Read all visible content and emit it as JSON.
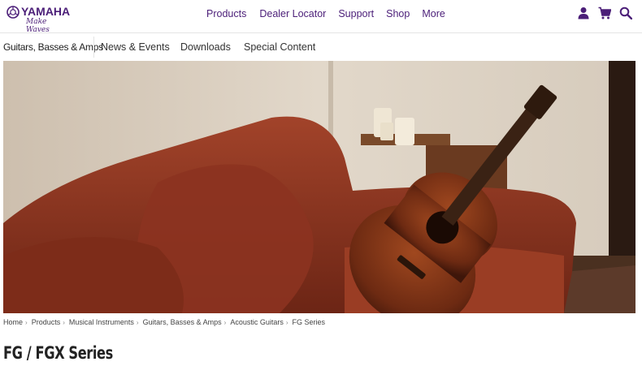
{
  "brand": {
    "name": "YAMAHA",
    "tagline": "Make Waves",
    "color": "#4b1e78"
  },
  "main_nav": {
    "items": [
      "Products",
      "Dealer Locator",
      "Support",
      "Shop",
      "More"
    ]
  },
  "header_icons": [
    "account-icon",
    "cart-icon",
    "search-icon"
  ],
  "sub_nav": {
    "category": "Guitars, Basses & Amps",
    "items": [
      "News & Events",
      "Downloads",
      "Special Content"
    ]
  },
  "hero": {
    "alt": "acoustic-guitar-on-red-sofa"
  },
  "breadcrumb": [
    "Home",
    "Products",
    "Musical Instruments",
    "Guitars, Basses & Amps",
    "Acoustic Guitars",
    "FG Series"
  ],
  "page_title": "FG / FGX Series"
}
